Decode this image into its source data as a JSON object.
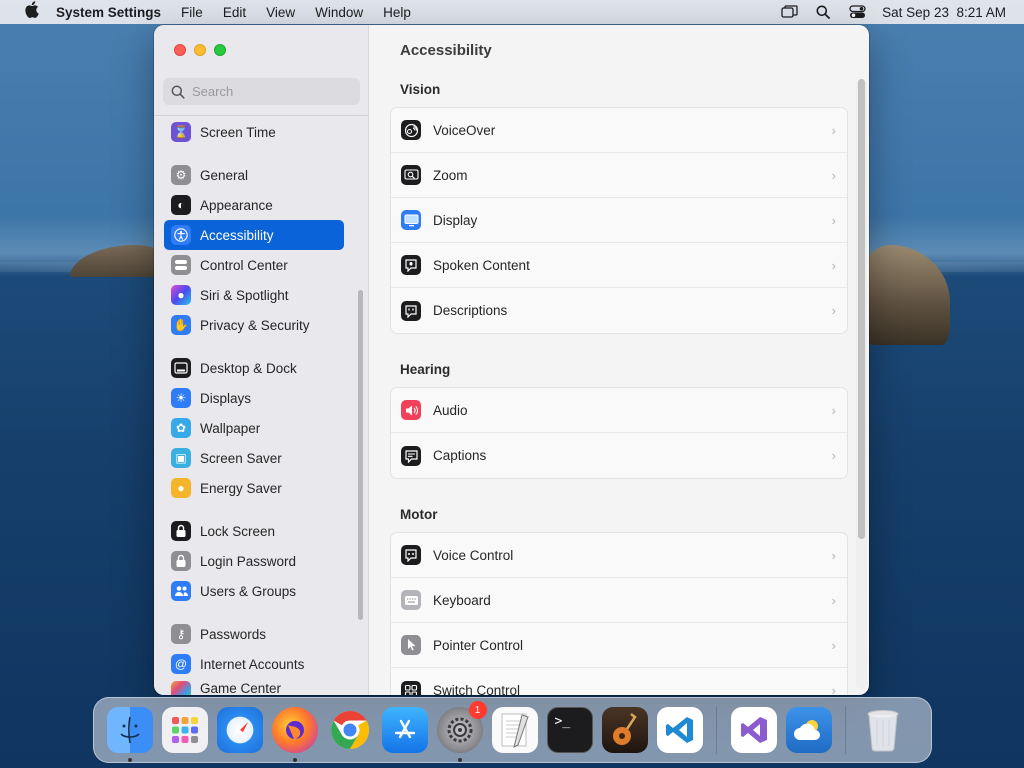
{
  "menubar": {
    "app_name": "System Settings",
    "menus": [
      "File",
      "Edit",
      "View",
      "Window",
      "Help"
    ],
    "clock": "Sat Sep 23  8:21 AM"
  },
  "window": {
    "search_placeholder": "Search",
    "sidebar": [
      {
        "label": "Screen Time",
        "icon": "hourglass-icon",
        "color": "#6e52d6"
      },
      {
        "label": "General",
        "icon": "gear-icon",
        "color": "#8e8e93"
      },
      {
        "label": "Appearance",
        "icon": "appearance-icon",
        "color": "#1c1c1e"
      },
      {
        "label": "Accessibility",
        "icon": "accessibility-icon",
        "color": "#0a63d8",
        "active": true
      },
      {
        "label": "Control Center",
        "icon": "control-center-icon",
        "color": "#8e8e93"
      },
      {
        "label": "Siri & Spotlight",
        "icon": "siri-icon",
        "color": "#7b3fe4"
      },
      {
        "label": "Privacy & Security",
        "icon": "hand-icon",
        "color": "#2f7df6"
      },
      {
        "label": "Desktop & Dock",
        "icon": "dock-icon",
        "color": "#1c1c1e"
      },
      {
        "label": "Displays",
        "icon": "sun-icon",
        "color": "#2f7df6"
      },
      {
        "label": "Wallpaper",
        "icon": "flower-icon",
        "color": "#38a9e8"
      },
      {
        "label": "Screen Saver",
        "icon": "screensaver-icon",
        "color": "#3ab0e0"
      },
      {
        "label": "Energy Saver",
        "icon": "bulb-icon",
        "color": "#f5b52b"
      },
      {
        "label": "Lock Screen",
        "icon": "lock-icon",
        "color": "#1c1c1e"
      },
      {
        "label": "Login Password",
        "icon": "lock-gray-icon",
        "color": "#8e8e93"
      },
      {
        "label": "Users & Groups",
        "icon": "users-icon",
        "color": "#2f7df6"
      },
      {
        "label": "Passwords",
        "icon": "key-icon",
        "color": "#8e8e93"
      },
      {
        "label": "Internet Accounts",
        "icon": "at-icon",
        "color": "#2f7df6"
      },
      {
        "label": "Game Center",
        "icon": "game-center-icon",
        "color": "#e8e8e8"
      }
    ],
    "content_title": "Accessibility",
    "sections": [
      {
        "title": "Vision",
        "rows": [
          {
            "label": "VoiceOver",
            "icon": "voiceover-icon",
            "color": "#1c1c1e"
          },
          {
            "label": "Zoom",
            "icon": "zoom-icon",
            "color": "#1c1c1e"
          },
          {
            "label": "Display",
            "icon": "display-icon",
            "color": "#2f7df6"
          },
          {
            "label": "Spoken Content",
            "icon": "spoken-content-icon",
            "color": "#1c1c1e"
          },
          {
            "label": "Descriptions",
            "icon": "descriptions-icon",
            "color": "#1c1c1e"
          }
        ]
      },
      {
        "title": "Hearing",
        "rows": [
          {
            "label": "Audio",
            "icon": "speaker-icon",
            "color": "#f0405a"
          },
          {
            "label": "Captions",
            "icon": "captions-icon",
            "color": "#1c1c1e"
          }
        ]
      },
      {
        "title": "Motor",
        "rows": [
          {
            "label": "Voice Control",
            "icon": "voice-control-icon",
            "color": "#1c1c1e"
          },
          {
            "label": "Keyboard",
            "icon": "keyboard-icon",
            "color": "#9a9a9e"
          },
          {
            "label": "Pointer Control",
            "icon": "pointer-icon",
            "color": "#8e8e93"
          },
          {
            "label": "Switch Control",
            "icon": "switch-control-icon",
            "color": "#1c1c1e"
          }
        ]
      }
    ]
  },
  "dock": {
    "apps": [
      {
        "name": "Finder",
        "icon": "finder-icon",
        "color": "#3a8ef6",
        "running": true
      },
      {
        "name": "Launchpad",
        "icon": "launchpad-icon",
        "color": "#e8e8ec"
      },
      {
        "name": "Safari",
        "icon": "safari-icon",
        "color": "#2a8bf0"
      },
      {
        "name": "Firefox",
        "icon": "firefox-icon",
        "color": "#7b2ad0",
        "running": true
      },
      {
        "name": "Chrome",
        "icon": "chrome-icon",
        "color": "#ffffff"
      },
      {
        "name": "App Store",
        "icon": "app-store-icon",
        "color": "#1b8ff2"
      },
      {
        "name": "System Settings",
        "icon": "settings-icon",
        "color": "#8b8b90",
        "running": true,
        "badge": "1"
      },
      {
        "name": "TextEdit",
        "icon": "textedit-icon",
        "color": "#f2f2f2"
      },
      {
        "name": "Terminal",
        "icon": "terminal-icon",
        "color": "#1c1c1e"
      },
      {
        "name": "GarageBand",
        "icon": "garageband-icon",
        "color": "#3a2a1e"
      },
      {
        "name": "VS Code",
        "icon": "vscode-icon",
        "color": "#ffffff"
      }
    ],
    "extras": [
      {
        "name": "Visual Studio",
        "icon": "visual-studio-icon",
        "color": "#ffffff"
      },
      {
        "name": "Weather",
        "icon": "weather-icon",
        "color": "#2d7fd8"
      }
    ],
    "trash": {
      "name": "Trash",
      "icon": "trash-icon"
    }
  }
}
